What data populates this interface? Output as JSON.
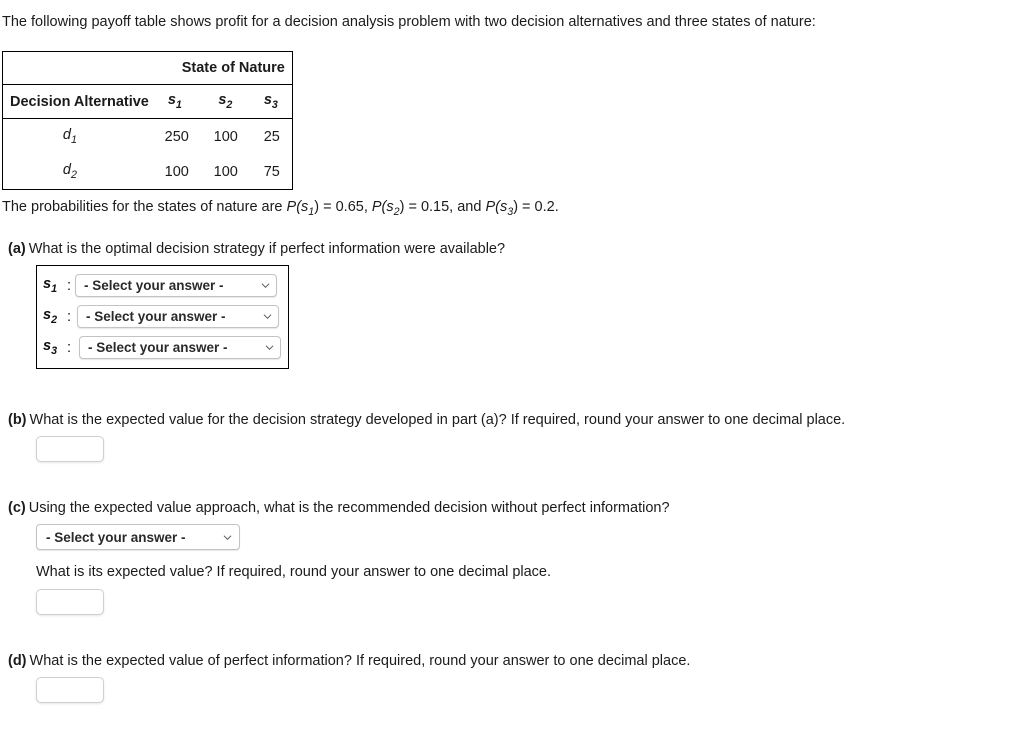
{
  "intro": "The following payoff table shows profit for a decision analysis problem with two decision alternatives and three states of nature:",
  "table": {
    "state_of_nature_header": "State of Nature",
    "decision_alternative_header": "Decision Alternative",
    "state_columns": [
      {
        "base": "s",
        "sub": "1"
      },
      {
        "base": "s",
        "sub": "2"
      },
      {
        "base": "s",
        "sub": "3"
      }
    ],
    "rows": [
      {
        "alt_base": "d",
        "alt_sub": "1",
        "values": [
          "250",
          "100",
          "25"
        ]
      },
      {
        "alt_base": "d",
        "alt_sub": "2",
        "values": [
          "100",
          "100",
          "75"
        ]
      }
    ]
  },
  "probabilities": {
    "prefix": "The probabilities for the states of nature are ",
    "p1_label": "P(s",
    "p1_sub": "1",
    "p1_value": ") = 0.65, ",
    "p2_label": "P(s",
    "p2_sub": "2",
    "p2_value": ") = 0.15, and ",
    "p3_label": "P(s",
    "p3_sub": "3",
    "p3_value": ") = 0.2."
  },
  "questions": {
    "a": {
      "label": "(a)",
      "text": "What is the optimal decision strategy if perfect information were available?",
      "rows": [
        {
          "label_base": "s",
          "label_sub": "1",
          "colon": ":",
          "select_value": "- Select your answer -"
        },
        {
          "label_base": "s",
          "label_sub": "2",
          "colon": ":",
          "select_value": "- Select your answer -"
        },
        {
          "label_base": "s",
          "label_sub": "3",
          "colon": ":",
          "select_value": "- Select your answer -"
        }
      ]
    },
    "b": {
      "label": "(b)",
      "text": "What is the expected value for the decision strategy developed in part (a)? If required, round your answer to one decimal place.",
      "answer_value": "",
      "answer_placeholder": ""
    },
    "c": {
      "label": "(c)",
      "text": "Using the expected value approach, what is the recommended decision without perfect information?",
      "select_value": "- Select your answer -",
      "subtext": "What is its expected value? If required, round your answer to one decimal place.",
      "answer_value": "",
      "answer_placeholder": ""
    },
    "d": {
      "label": "(d)",
      "text": "What is the expected value of perfect information? If required, round your answer to one decimal place.",
      "answer_value": "",
      "answer_placeholder": ""
    }
  },
  "colors": {
    "text": "#1b1b1b",
    "table_border": "#000000",
    "control_border": "#c3c3c3",
    "background": "#ffffff"
  }
}
